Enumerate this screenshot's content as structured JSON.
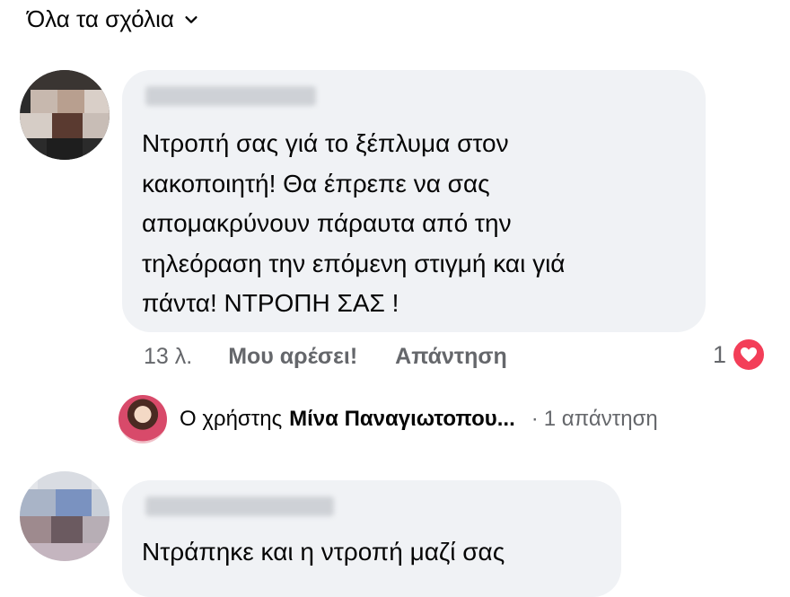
{
  "filter": {
    "label": "Όλα τα σχόλια"
  },
  "comment1": {
    "lines": [
      "Ντροπή σας γιά το ξέπλυμα στον",
      "κακοποιητή! Θα έπρεπε να σας",
      "απομακρύνουν πάραυτα από την",
      "τηλεόραση την επόμενη στιγμή και γιά",
      "πάντα! ΝΤΡΟΠΗ ΣΑΣ !"
    ],
    "time": "13 λ.",
    "like_label": "Μου αρέσει!",
    "reply_label": "Απάντηση",
    "reaction_count": "1",
    "reaction_icon": "heart-icon",
    "reaction_color": "#f33e58"
  },
  "replies": {
    "prefix": "Ο χρήστης",
    "user": "Μίνα Παναγιωτοπου...",
    "separator": "·",
    "count": "1 απάντηση"
  },
  "comment2": {
    "text": "Ντράπηκε και η ντροπή μαζί σας"
  }
}
